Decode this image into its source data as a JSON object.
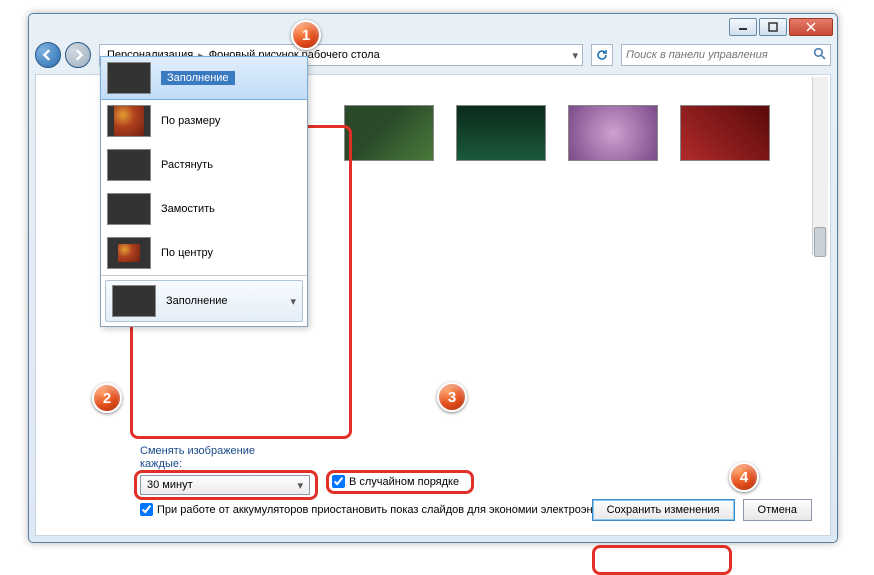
{
  "breadcrumb": {
    "item1": "Персонализация",
    "item2": "Фоновый рисунок рабочего стола"
  },
  "search": {
    "placeholder": "Поиск в панели управления"
  },
  "position_options": {
    "fill": "Заполнение",
    "fit": "По размеру",
    "stretch": "Растянуть",
    "tile": "Замостить",
    "center": "По центру",
    "current": "Заполнение"
  },
  "change": {
    "label_line1": "Сменять изображение",
    "label_line2": "каждые:",
    "interval": "30 минут"
  },
  "shuffle": {
    "label": "В случайном порядке"
  },
  "battery": {
    "label": "При работе от аккумуляторов приостановить показ слайдов для экономии электроэнергии"
  },
  "buttons": {
    "save": "Сохранить изменения",
    "cancel": "Отмена"
  },
  "badges": {
    "b1": "1",
    "b2": "2",
    "b3": "3",
    "b4": "4"
  }
}
